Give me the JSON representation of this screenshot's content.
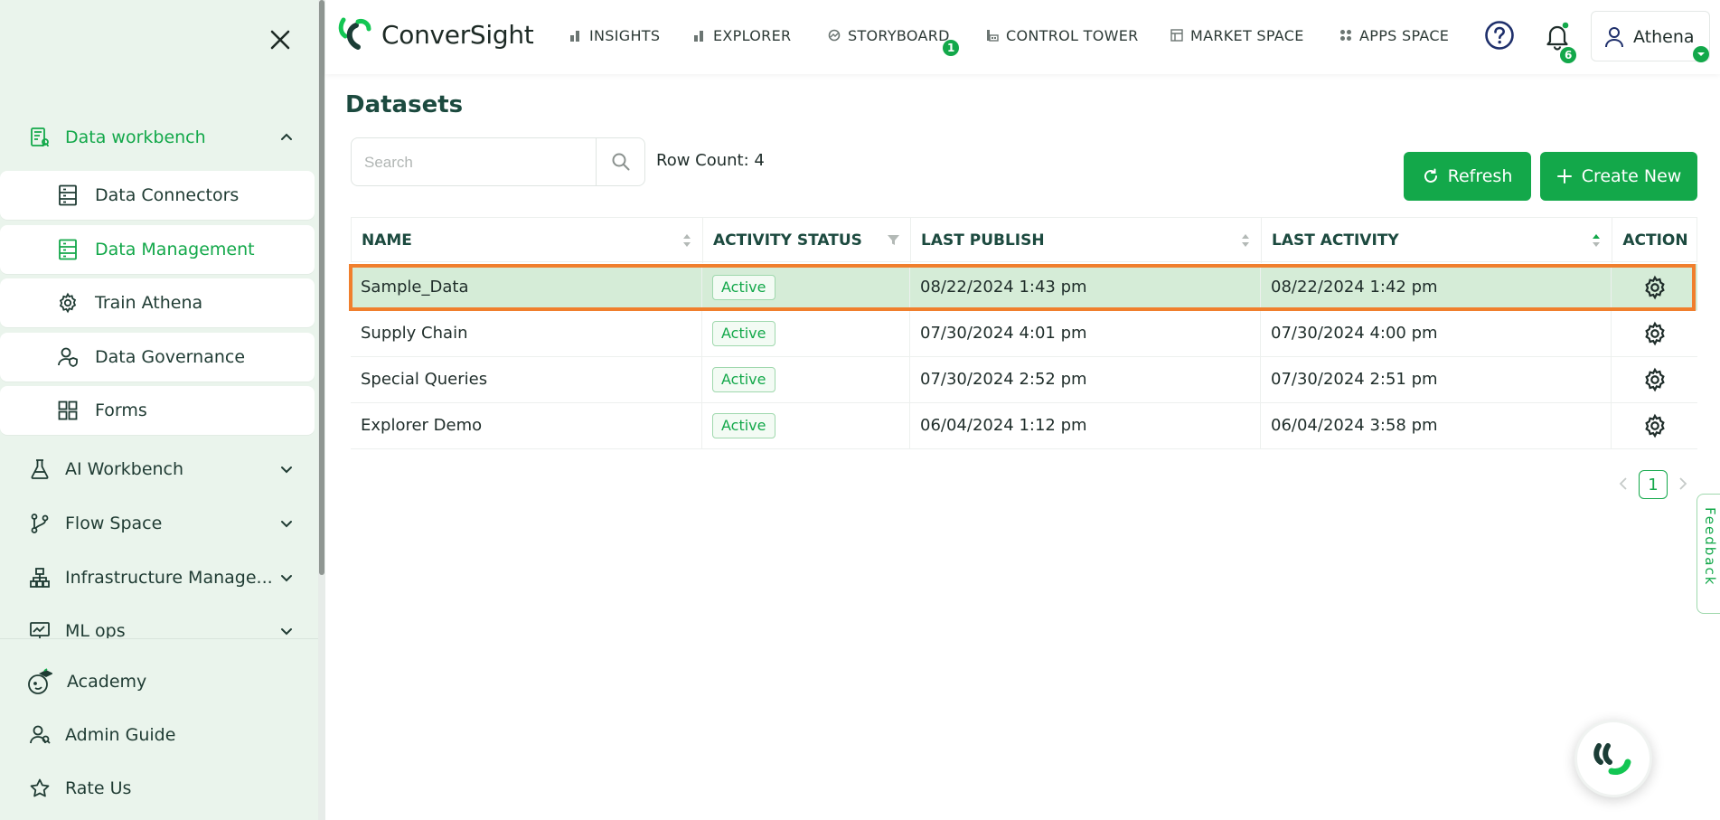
{
  "sidebar": {
    "groups": [
      {
        "label": "Data workbench",
        "icon": "data-workbench-icon",
        "expanded": true
      },
      {
        "label": "AI Workbench",
        "icon": "flask-icon"
      },
      {
        "label": "Flow Space",
        "icon": "branch-icon"
      },
      {
        "label": "Infrastructure Manage...",
        "icon": "infrastructure-icon"
      },
      {
        "label": "ML ops",
        "icon": "chart-monitor-icon"
      }
    ],
    "sub_items": [
      {
        "label": "Data Connectors",
        "icon": "server-icon"
      },
      {
        "label": "Data Management",
        "icon": "server-icon",
        "active": true
      },
      {
        "label": "Train Athena",
        "icon": "gear-icon"
      },
      {
        "label": "Data Governance",
        "icon": "user-shield-icon"
      },
      {
        "label": "Forms",
        "icon": "grid-icon"
      }
    ],
    "bottom": [
      {
        "label": "Academy",
        "icon": "academy-icon"
      },
      {
        "label": "Admin Guide",
        "icon": "admin-guide-icon"
      },
      {
        "label": "Rate Us",
        "icon": "star-icon"
      }
    ]
  },
  "header": {
    "brand": "ConverSight",
    "nav": [
      {
        "label": "INSIGHTS",
        "icon": "bar-chart-icon"
      },
      {
        "label": "EXPLORER",
        "icon": "bar-chart-icon"
      },
      {
        "label": "STORYBOARD",
        "icon": "storyboard-icon",
        "badge": "1"
      },
      {
        "label": "CONTROL TOWER",
        "icon": "control-tower-icon"
      },
      {
        "label": "MARKET SPACE",
        "icon": "market-icon"
      },
      {
        "label": "APPS SPACE",
        "icon": "apps-icon"
      }
    ],
    "notifications_count": "6",
    "user_name": "Athena"
  },
  "main": {
    "title": "Datasets",
    "search_placeholder": "Search",
    "row_count": "Row Count: 4",
    "refresh_label": "Refresh",
    "create_label": "Create New",
    "columns": [
      "NAME",
      "ACTIVITY STATUS",
      "LAST PUBLISH",
      "LAST ACTIVITY",
      "ACTION"
    ],
    "rows": [
      {
        "name": "Sample_Data",
        "status": "Active",
        "last_publish": "08/22/2024 1:43 pm",
        "last_activity": "08/22/2024 1:42 pm",
        "highlighted": true
      },
      {
        "name": "Supply Chain",
        "status": "Active",
        "last_publish": "07/30/2024 4:01 pm",
        "last_activity": "07/30/2024 4:00 pm"
      },
      {
        "name": "Special Queries",
        "status": "Active",
        "last_publish": "07/30/2024 2:52 pm",
        "last_activity": "07/30/2024 2:51 pm"
      },
      {
        "name": "Explorer Demo",
        "status": "Active",
        "last_publish": "06/04/2024 1:12 pm",
        "last_activity": "06/04/2024 3:58 pm"
      }
    ],
    "pagination": {
      "current_page": "1"
    },
    "feedback_label": "Feedback"
  },
  "colors": {
    "accent": "#13a84a",
    "sidebar_bg": "#eaf4ec",
    "highlight_row": "#d5ecd7",
    "highlight_frame": "#f07f2d",
    "title": "#1c4a3f"
  }
}
